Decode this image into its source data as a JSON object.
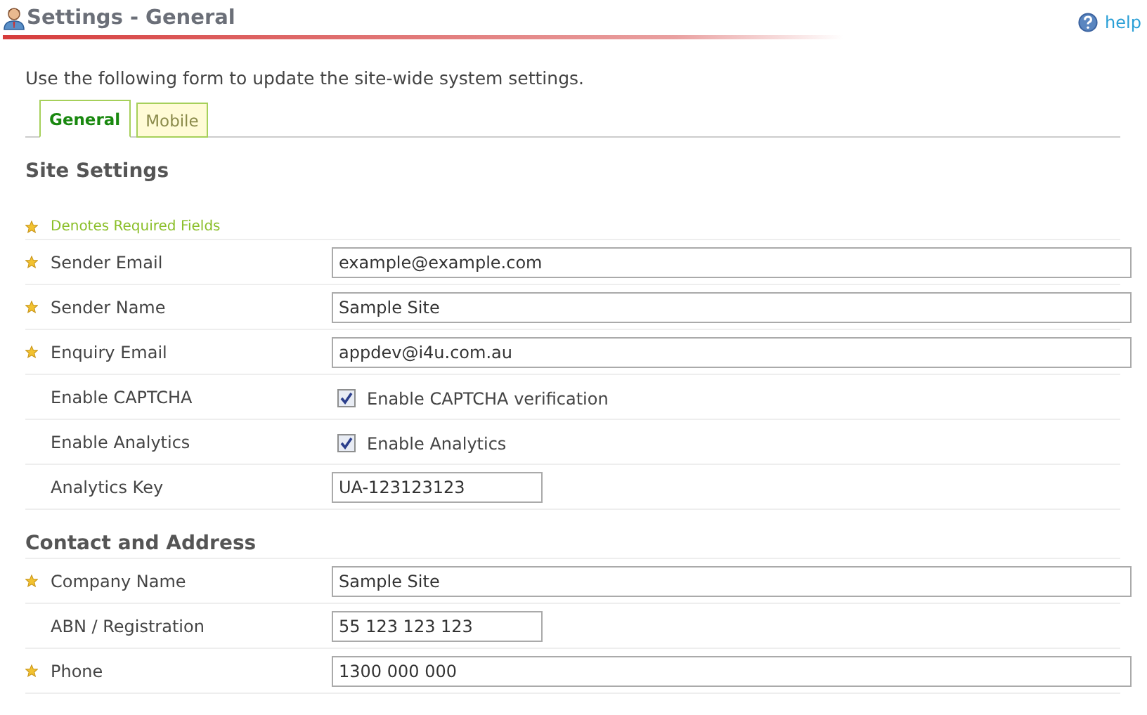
{
  "header": {
    "title": "Settings - General",
    "help": "help"
  },
  "intro": "Use the following form to update the site-wide system settings.",
  "tabs": [
    {
      "label": "General",
      "selected": true
    },
    {
      "label": "Mobile",
      "selected": false
    }
  ],
  "sections": [
    {
      "title": "Site Settings",
      "note": "Denotes Required Fields",
      "rows": [
        {
          "label": "Sender Email",
          "required": true,
          "kind": "text",
          "value": "example@example.com"
        },
        {
          "label": "Sender Name",
          "required": true,
          "kind": "text",
          "value": "Sample Site"
        },
        {
          "label": "Enquiry Email",
          "required": true,
          "kind": "text",
          "value": "appdev@i4u.com.au"
        },
        {
          "label": "Enable CAPTCHA",
          "required": false,
          "kind": "checkbox",
          "checked": true,
          "text": "Enable CAPTCHA verification"
        },
        {
          "label": "Enable Analytics",
          "required": false,
          "kind": "checkbox",
          "checked": true,
          "text": "Enable Analytics"
        },
        {
          "label": "Analytics Key",
          "required": false,
          "kind": "short",
          "value": "UA-123123123"
        }
      ]
    },
    {
      "title": "Contact and Address",
      "rows": [
        {
          "label": "Company Name",
          "required": true,
          "kind": "text",
          "value": "Sample Site"
        },
        {
          "label": "ABN / Registration",
          "required": false,
          "kind": "short",
          "value": "55 123 123 123"
        },
        {
          "label": "Phone",
          "required": true,
          "kind": "text",
          "value": "1300 000 000"
        }
      ]
    }
  ]
}
